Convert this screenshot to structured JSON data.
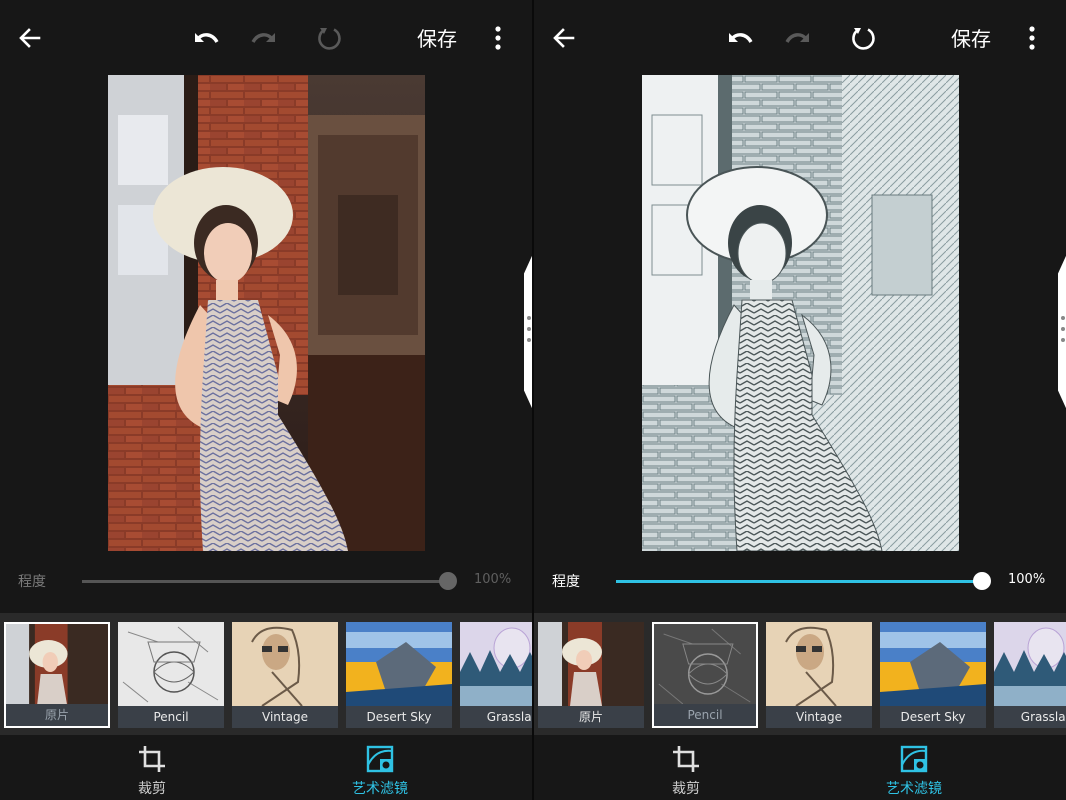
{
  "panels": [
    {
      "save_label": "保存",
      "slider": {
        "label": "程度",
        "value_text": "100%",
        "level": 1.0,
        "enabled": false
      },
      "filters": [
        {
          "label": "原片",
          "selected": true
        },
        {
          "label": "Pencil",
          "selected": false
        },
        {
          "label": "Vintage",
          "selected": false
        },
        {
          "label": "Desert Sky",
          "selected": false
        },
        {
          "label": "Grasslan",
          "selected": false
        }
      ],
      "nav": [
        {
          "label": "裁剪",
          "icon": "crop-icon",
          "active": false
        },
        {
          "label": "艺术滤镜",
          "icon": "art-filter-icon",
          "active": true
        }
      ],
      "photo_style": "original"
    },
    {
      "save_label": "保存",
      "slider": {
        "label": "程度",
        "value_text": "100%",
        "level": 1.0,
        "enabled": true
      },
      "filters": [
        {
          "label": "原片",
          "selected": false
        },
        {
          "label": "Pencil",
          "selected": true
        },
        {
          "label": "Vintage",
          "selected": false
        },
        {
          "label": "Desert Sky",
          "selected": false
        },
        {
          "label": "Grasslan",
          "selected": false
        }
      ],
      "nav": [
        {
          "label": "裁剪",
          "icon": "crop-icon",
          "active": false
        },
        {
          "label": "艺术滤镜",
          "icon": "art-filter-icon",
          "active": true
        }
      ],
      "photo_style": "pencil-sketch"
    }
  ],
  "colors": {
    "accent": "#2fc2e4",
    "background": "#171717",
    "strip": "#2a2a2a"
  },
  "icons": [
    "back-arrow-icon",
    "undo-icon",
    "redo-icon",
    "reset-icon",
    "more-vert-icon",
    "crop-icon",
    "art-filter-icon"
  ]
}
